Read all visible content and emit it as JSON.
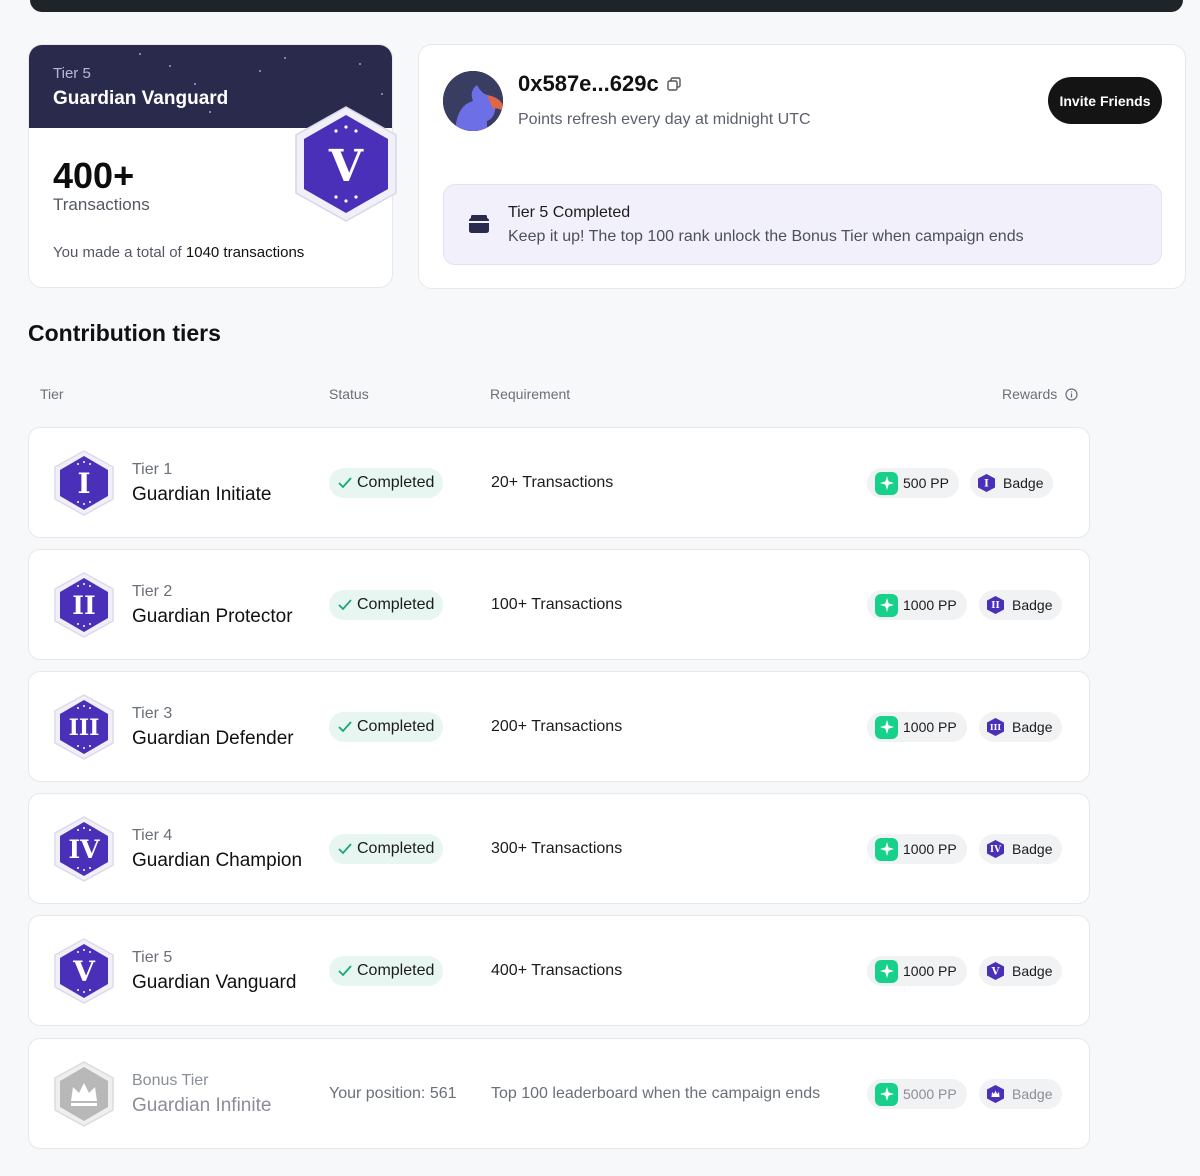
{
  "colors": {
    "accent": "#4a2fb8",
    "pp_green": "#17d18b",
    "dark": "#141414",
    "completed_bg": "#e7f6f0"
  },
  "current_tier": {
    "tier_label": "Tier 5",
    "tier_name": "Guardian Vanguard",
    "badge_numeral": "V",
    "count": "400+",
    "count_label": "Transactions",
    "total_prefix": "You made a total of",
    "total_value": "1040 transactions"
  },
  "profile": {
    "address": "0x587e...629c",
    "refresh_note": "Points refresh every day at midnight UTC",
    "invite_label": "Invite Friends",
    "notice_title": "Tier 5 Completed",
    "notice_text": "Keep it up! The top 100 rank unlock the Bonus Tier when campaign ends"
  },
  "section_title": "Contribution tiers",
  "columns": {
    "tier": "Tier",
    "status": "Status",
    "requirement": "Requirement",
    "rewards": "Rewards"
  },
  "tiers": [
    {
      "tier_label": "Tier 1",
      "name": "Guardian Initiate",
      "numeral": "I",
      "status": "Completed",
      "requirement": "20+ Transactions",
      "points": "500 PP",
      "badge_label": "Badge"
    },
    {
      "tier_label": "Tier 2",
      "name": "Guardian Protector",
      "numeral": "II",
      "status": "Completed",
      "requirement": "100+ Transactions",
      "points": "1000 PP",
      "badge_label": "Badge"
    },
    {
      "tier_label": "Tier 3",
      "name": "Guardian Defender",
      "numeral": "III",
      "status": "Completed",
      "requirement": "200+ Transactions",
      "points": "1000 PP",
      "badge_label": "Badge"
    },
    {
      "tier_label": "Tier 4",
      "name": "Guardian Champion",
      "numeral": "IV",
      "status": "Completed",
      "requirement": "300+ Transactions",
      "points": "1000 PP",
      "badge_label": "Badge"
    },
    {
      "tier_label": "Tier 5",
      "name": "Guardian Vanguard",
      "numeral": "V",
      "status": "Completed",
      "requirement": "400+ Transactions",
      "points": "1000 PP",
      "badge_label": "Badge"
    }
  ],
  "bonus_tier": {
    "tier_label": "Bonus Tier",
    "name": "Guardian Infinite",
    "position": "Your position: 561",
    "requirement": "Top 100 leaderboard when the campaign ends",
    "points": "5000 PP",
    "badge_label": "Badge"
  }
}
